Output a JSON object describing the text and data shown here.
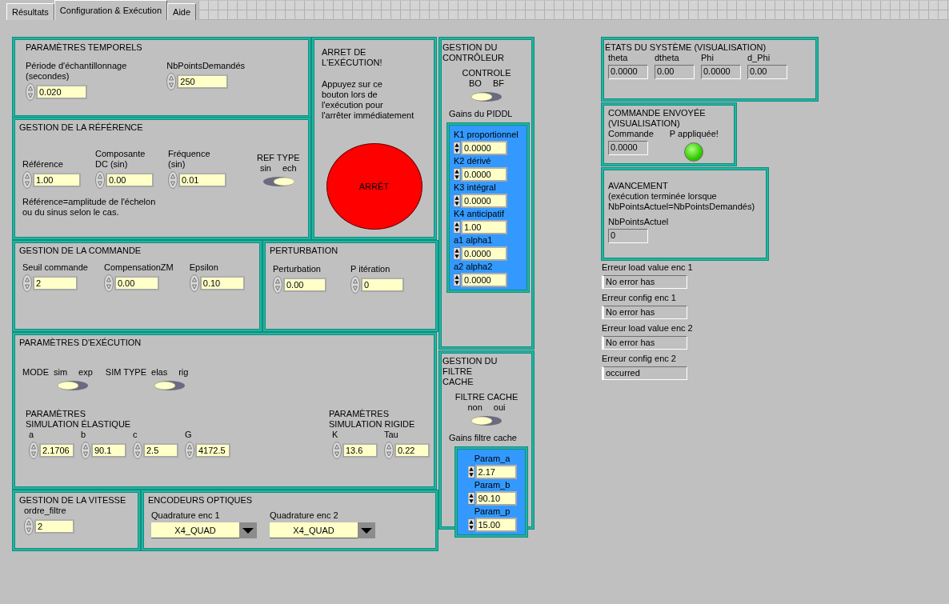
{
  "tabs": [
    {
      "label": "Résultats",
      "selected": false
    },
    {
      "label": "Configuration & Exécution",
      "selected": true
    },
    {
      "label": "Aide",
      "selected": false
    }
  ],
  "temporels": {
    "title": "PARAMÈTRES TEMPORELS",
    "fields": [
      {
        "label": "Période d'échantillonnage\n(secondes)",
        "value": "0.020"
      },
      {
        "label": "NbPointsDemandés",
        "value": "250"
      }
    ]
  },
  "reference": {
    "title": "GESTION DE LA RÉFÉRENCE",
    "fields": [
      {
        "label": "Référence",
        "value": "1.00"
      },
      {
        "label": "Composante\nDC (sin)",
        "value": "0.00"
      },
      {
        "label": "Fréquence\n(sin)",
        "value": "0.01"
      }
    ],
    "toggle": {
      "label": "REF TYPE",
      "off_label": "sin",
      "on_label": "ech",
      "on": true
    },
    "note": "Référence=amplitude de l'échelon\nou du sinus selon le cas."
  },
  "arret": {
    "title": "ARRET DE\nL'EXÉCUTION!",
    "instructions": "Appuyez sur ce\nbouton lors de\nl'exécution pour\nl'arrêter immédiatement",
    "button": "ARRÊT"
  },
  "commande": {
    "title": "GESTION DE LA COMMANDE",
    "fields": [
      {
        "label": "Seuil commande",
        "value": "2"
      },
      {
        "label": "CompensationZM",
        "value": "0.00"
      },
      {
        "label": "Epsilon",
        "value": "0.10"
      }
    ]
  },
  "perturbation": {
    "title": "PERTURBATION",
    "fields": [
      {
        "label": "Perturbation",
        "value": "0.00"
      },
      {
        "label": "P itération",
        "value": "0"
      }
    ]
  },
  "execution": {
    "title": "PARAMÈTRES D'EXÉCUTION",
    "toggles": [
      {
        "label": "MODE",
        "off_label": "sim",
        "on_label": "exp",
        "on": false
      },
      {
        "label": "SIM TYPE",
        "off_label": "elas",
        "on_label": "rig",
        "on": false
      }
    ],
    "elastique": {
      "title": "PARAMÈTRES\nSIMULATION ÉLASTIQUE",
      "fields": [
        {
          "label": "a",
          "value": "2.1706"
        },
        {
          "label": "b",
          "value": "90.1"
        },
        {
          "label": "c",
          "value": "2.5"
        },
        {
          "label": "G",
          "value": "4172.5"
        }
      ]
    },
    "rigide": {
      "title": "PARAMÈTRES\nSIMULATION RIGIDE",
      "fields": [
        {
          "label": "K",
          "value": "13.6"
        },
        {
          "label": "Tau",
          "value": "0.22"
        }
      ]
    }
  },
  "vitesse": {
    "title": "GESTION DE LA VITESSE",
    "fields": [
      {
        "label": "ordre_filtre",
        "value": "2"
      }
    ]
  },
  "encodeurs": {
    "title": "ENCODEURS OPTIQUES",
    "dropdowns": [
      {
        "label": "Quadrature enc 1",
        "value": "X4_QUAD"
      },
      {
        "label": "Quadrature enc 2",
        "value": "X4_QUAD"
      }
    ]
  },
  "controleur": {
    "title": "GESTION DU\nCONTRÔLEUR",
    "toggle": {
      "label": "CONTROLE",
      "off_label": "BO",
      "on_label": "BF",
      "on": false
    },
    "gains_label": "Gains du PIDDL",
    "gains": [
      {
        "label": "K1 proportionnel",
        "value": "0.0000"
      },
      {
        "label": "K2  dérivé",
        "value": "0.0000"
      },
      {
        "label": "K3  intégral",
        "value": "0.0000"
      },
      {
        "label": "K4  anticipatif",
        "value": "1.00"
      },
      {
        "label": "a1 alpha1",
        "value": "0.0000"
      },
      {
        "label": "a2 alpha2",
        "value": "0.0000"
      }
    ]
  },
  "filtre": {
    "title": "GESTION DU FILTRE\nCACHE",
    "toggle": {
      "label": "FILTRE CACHE",
      "off_label": "non",
      "on_label": "oui",
      "on": false
    },
    "gains_label": "Gains filtre cache",
    "gains": [
      {
        "label": "Param_a",
        "value": "2.17"
      },
      {
        "label": "Param_b",
        "value": "90.10"
      },
      {
        "label": "Param_p",
        "value": "15.00"
      }
    ]
  },
  "etats": {
    "title": "ÉTATS DU SYSTÈME (VISUALISATION)",
    "indicators": [
      {
        "label": "theta",
        "value": "0.0000"
      },
      {
        "label": "dtheta",
        "value": "0.00"
      },
      {
        "label": "Phi",
        "value": "0.0000"
      },
      {
        "label": "d_Phi",
        "value": "0.00"
      }
    ]
  },
  "commande_envoyee": {
    "title": "COMMANDE ENVOYÉE\n(VISUALISATION)",
    "indicator": {
      "label": "Commande",
      "value": "0.0000"
    },
    "led": {
      "label": "P appliquée!",
      "on": true
    }
  },
  "avancement": {
    "title": "AVANCEMENT\n(exécution terminée lorsque\nNbPointsActuel=NbPointsDemandés)",
    "indicator": {
      "label": "NbPointsActuel",
      "value": "0"
    }
  },
  "errors": [
    {
      "label": "Erreur load value enc 1",
      "value": "No error has"
    },
    {
      "label": "Erreur config enc 1",
      "value": "No error has"
    },
    {
      "label": "Erreur load value enc 2",
      "value": "No error has"
    },
    {
      "label": "Erreur config enc 2",
      "value": "occurred"
    }
  ]
}
